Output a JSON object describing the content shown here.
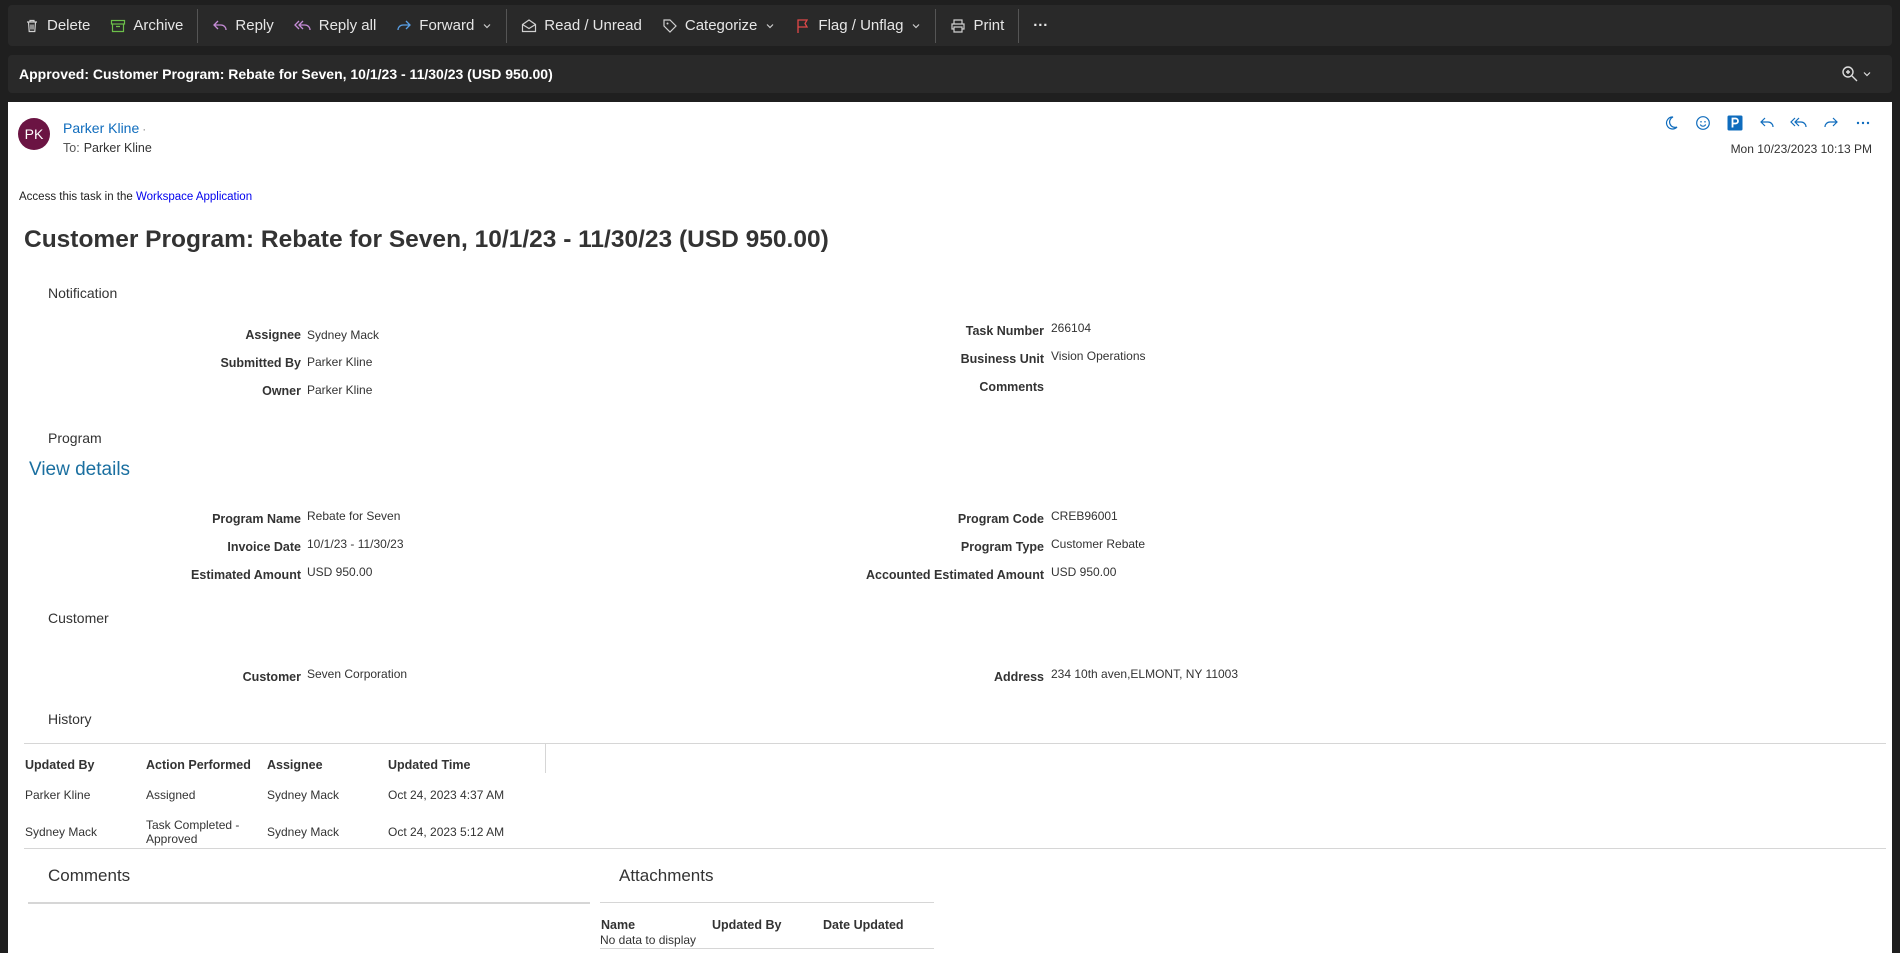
{
  "toolbar": {
    "delete": "Delete",
    "archive": "Archive",
    "reply": "Reply",
    "reply_all": "Reply all",
    "forward": "Forward",
    "read_unread": "Read / Unread",
    "categorize": "Categorize",
    "flag": "Flag / Unflag",
    "print": "Print",
    "more": "···"
  },
  "subject": "Approved: Customer Program: Rebate for Seven, 10/1/23 - 11/30/23 (USD 950.00)",
  "message": {
    "avatar_initials": "PK",
    "sender": "Parker Kline",
    "sender_suffix": "·",
    "to_label": "To:",
    "to": "Parker Kline",
    "date": "Mon 10/23/2023 10:13 PM",
    "accent_color": "#0f6cbd",
    "avatar_color": "#6b1443"
  },
  "body": {
    "access_prefix": "Access this task in the ",
    "access_link": "Workspace Application",
    "title": "Customer Program: Rebate for Seven, 10/1/23 - 11/30/23 (USD 950.00)",
    "notification": {
      "heading": "Notification",
      "assignee_label": "Assignee",
      "assignee": "Sydney Mack",
      "submitted_by_label": "Submitted By",
      "submitted_by": "Parker Kline",
      "owner_label": "Owner",
      "owner": "Parker Kline",
      "task_number_label": "Task Number",
      "task_number": "266104",
      "business_unit_label": "Business Unit",
      "business_unit": "Vision Operations",
      "comments_label": "Comments",
      "comments": ""
    },
    "program": {
      "heading": "Program",
      "view_details": "View details",
      "program_name_label": "Program Name",
      "program_name": "Rebate for Seven",
      "invoice_date_label": "Invoice Date",
      "invoice_date": "10/1/23 - 11/30/23",
      "estimated_amount_label": "Estimated Amount",
      "estimated_amount": "USD 950.00",
      "program_code_label": "Program Code",
      "program_code": "CREB96001",
      "program_type_label": "Program Type",
      "program_type": "Customer Rebate",
      "accounted_amount_label": "Accounted Estimated Amount",
      "accounted_amount": "USD 950.00"
    },
    "customer": {
      "heading": "Customer",
      "customer_label": "Customer",
      "customer": "Seven Corporation",
      "address_label": "Address",
      "address": "234 10th aven,ELMONT, NY 11003"
    },
    "history": {
      "heading": "History",
      "columns": [
        "Updated By",
        "Action Performed",
        "Assignee",
        "Updated Time"
      ],
      "rows": [
        [
          "Parker Kline",
          "Assigned",
          "Sydney Mack",
          "Oct 24, 2023 4:37 AM"
        ],
        [
          "Sydney Mack",
          "Task Completed - Approved",
          "Sydney Mack",
          "Oct 24, 2023 5:12 AM"
        ]
      ]
    },
    "comments_heading": "Comments",
    "attachments": {
      "heading": "Attachments",
      "columns": [
        "Name",
        "Updated By",
        "Date Updated"
      ],
      "empty": "No data to display"
    }
  }
}
